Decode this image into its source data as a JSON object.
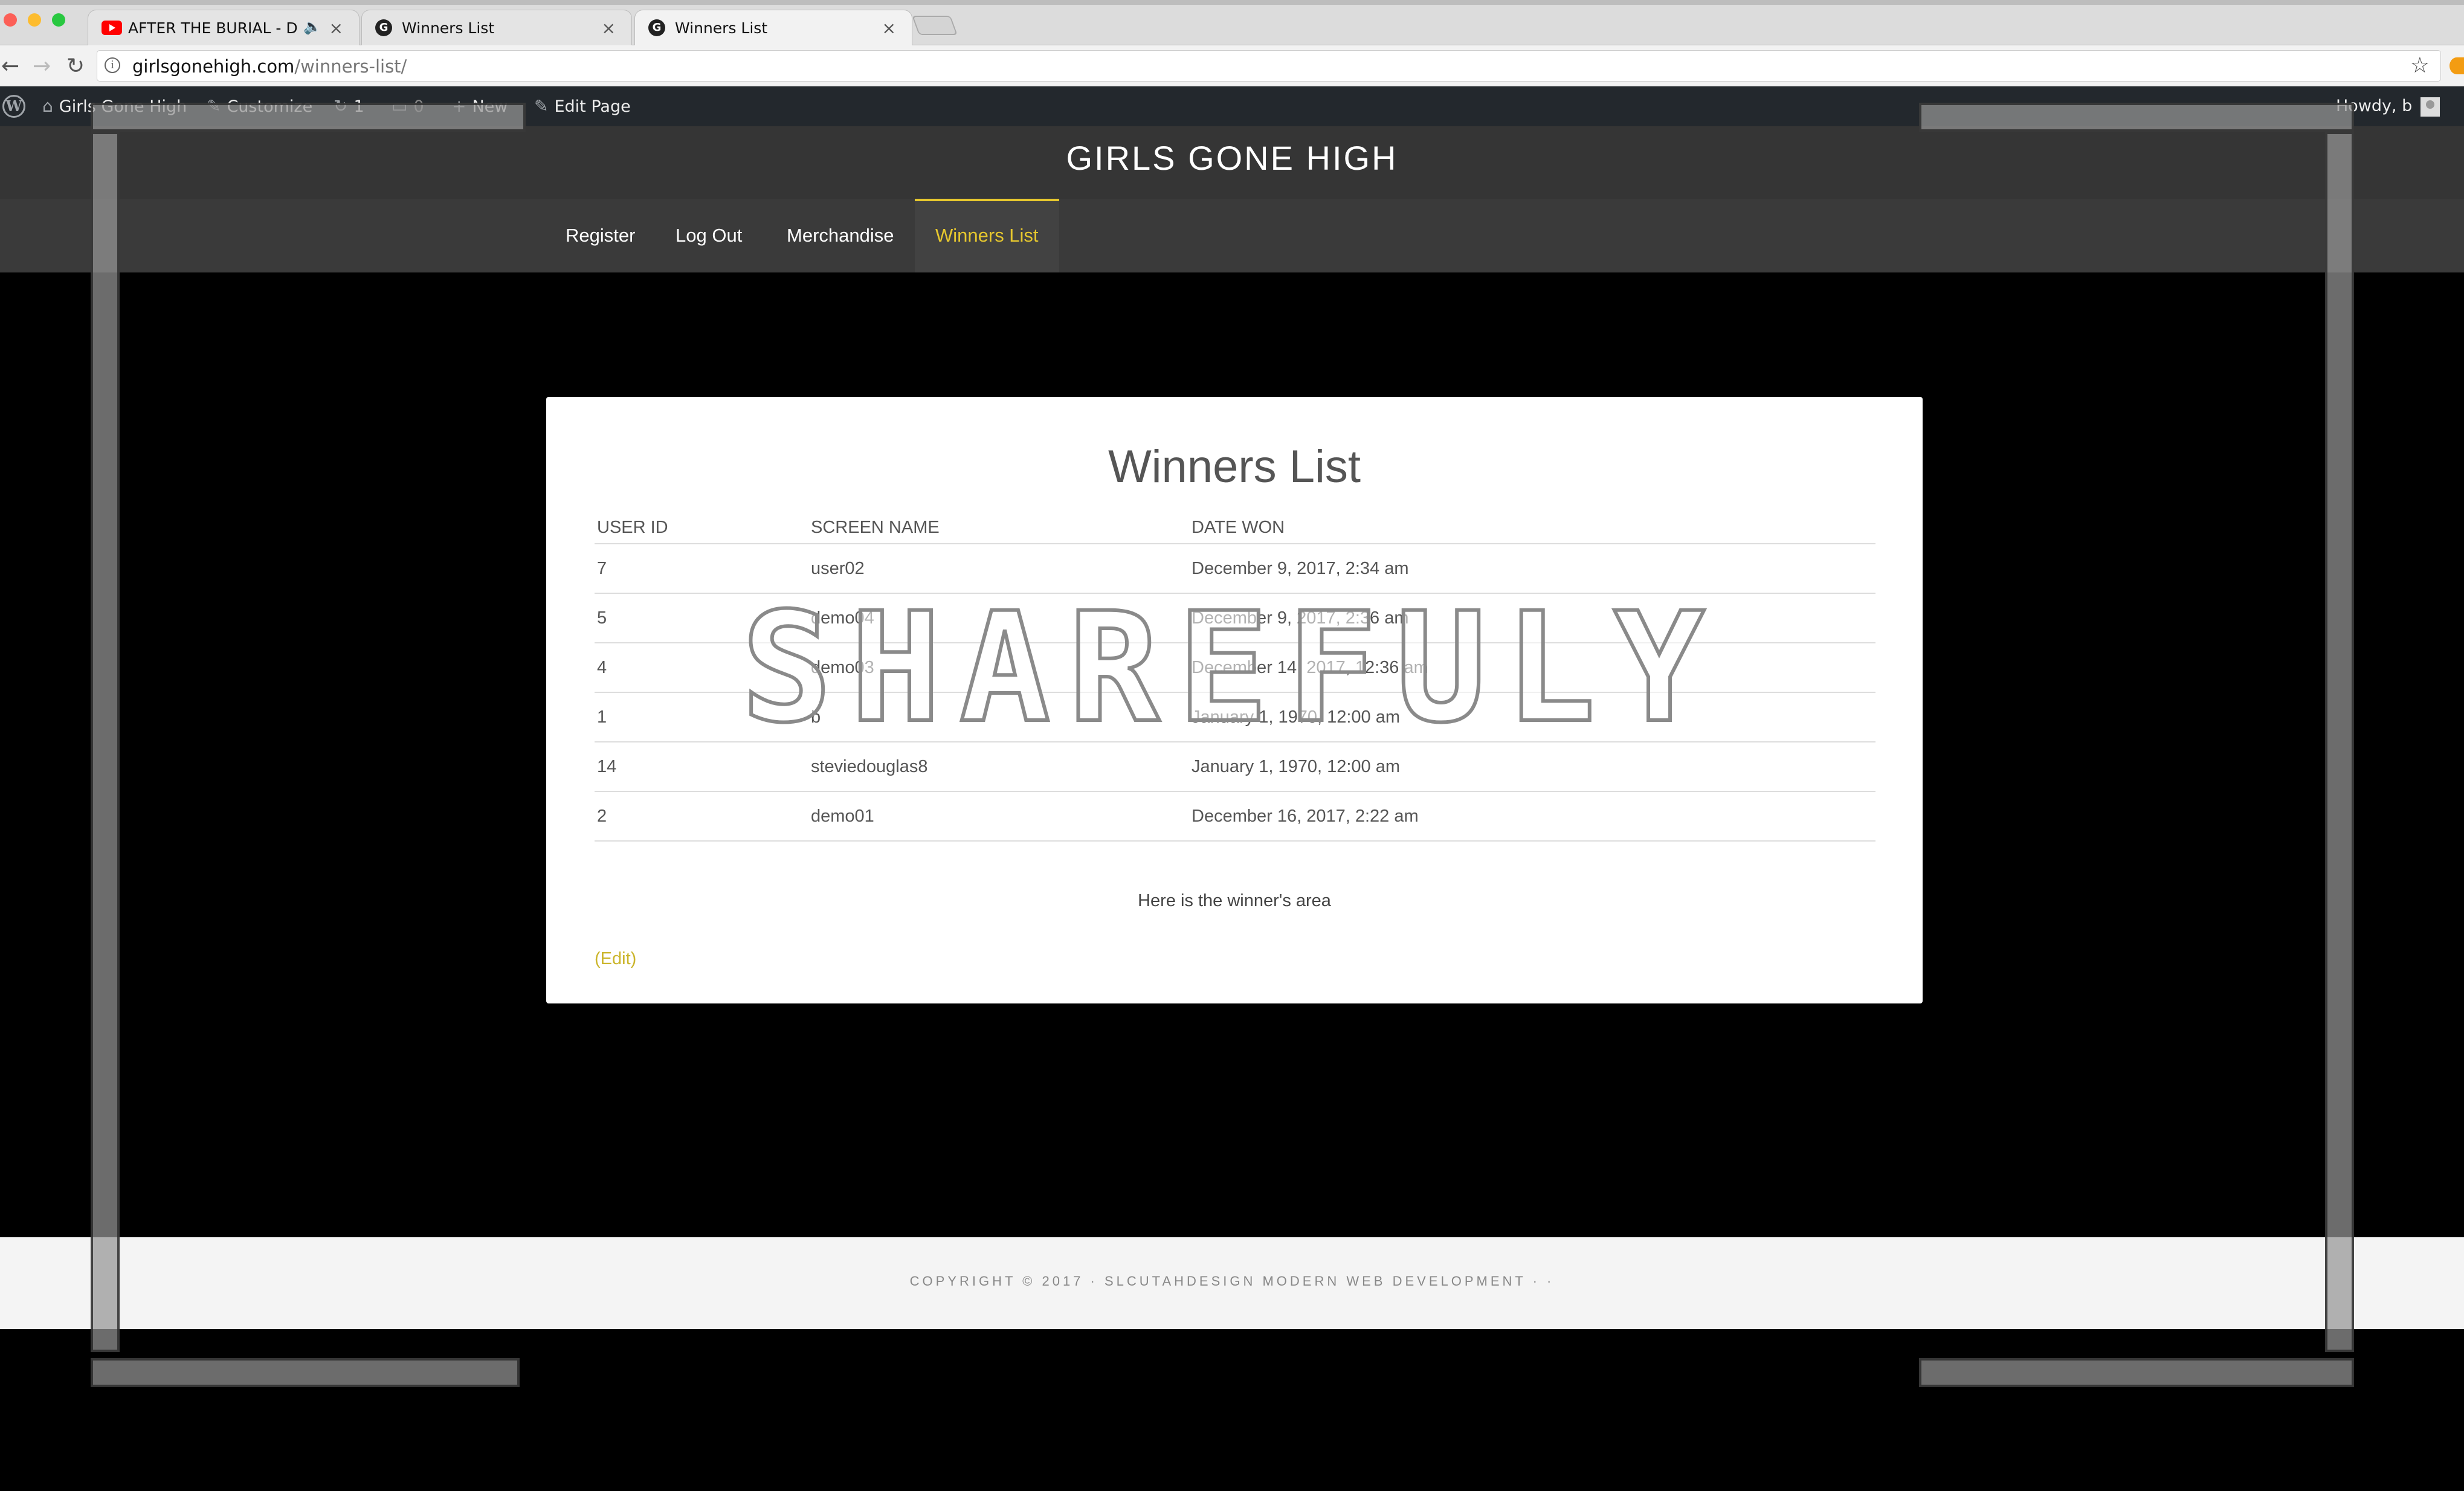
{
  "browser": {
    "tabs": [
      {
        "title": "AFTER THE BURIAL - Delug",
        "favicon": "youtube-icon",
        "audio": "🔈"
      },
      {
        "title": "Winners List",
        "favicon": "G"
      },
      {
        "title": "Winners List",
        "favicon": "G",
        "active": true
      }
    ],
    "close_glyph": "×",
    "url_domain": "girlsgonehigh.com",
    "url_path": "/winners-list/",
    "info_glyph": "i",
    "star_glyph": "☆",
    "back_glyph": "←",
    "forward_glyph": "→",
    "reload_glyph": "↻"
  },
  "adminbar": {
    "site_name": "Girls Gone High",
    "customize": "Customize",
    "updates_count": "1",
    "comments_count": "0",
    "new_label": "New",
    "edit_page": "Edit Page",
    "howdy": "Howdy, b",
    "wp_logo": "W"
  },
  "site": {
    "title": "GIRLS GONE HIGH",
    "nav": [
      "Register",
      "Log Out",
      "Merchandise",
      "Winners List"
    ],
    "active_nav": "Winners List",
    "accent_color": "#e6c72e"
  },
  "page": {
    "title": "Winners List",
    "columns": [
      "USER ID",
      "SCREEN NAME",
      "DATE WON"
    ],
    "rows": [
      [
        "7",
        "user02",
        "December 9, 2017, 2:34 am"
      ],
      [
        "5",
        "demo04",
        "December 9, 2017, 2:36 am"
      ],
      [
        "4",
        "demo03",
        "December 14, 2017, 12:36 am"
      ],
      [
        "1",
        "b",
        "January 1, 1970, 12:00 am"
      ],
      [
        "14",
        "steviedouglas8",
        "January 1, 1970, 12:00 am"
      ],
      [
        "2",
        "demo01",
        "December 16, 2017, 2:22 am"
      ]
    ],
    "note": "Here is the winner's area",
    "edit_link": "(Edit)"
  },
  "footer": {
    "text": "COPYRIGHT © 2017 · SLCUTAHDESIGN MODERN WEB DEVELOPMENT · ·"
  },
  "watermark": "SHAREFULY"
}
